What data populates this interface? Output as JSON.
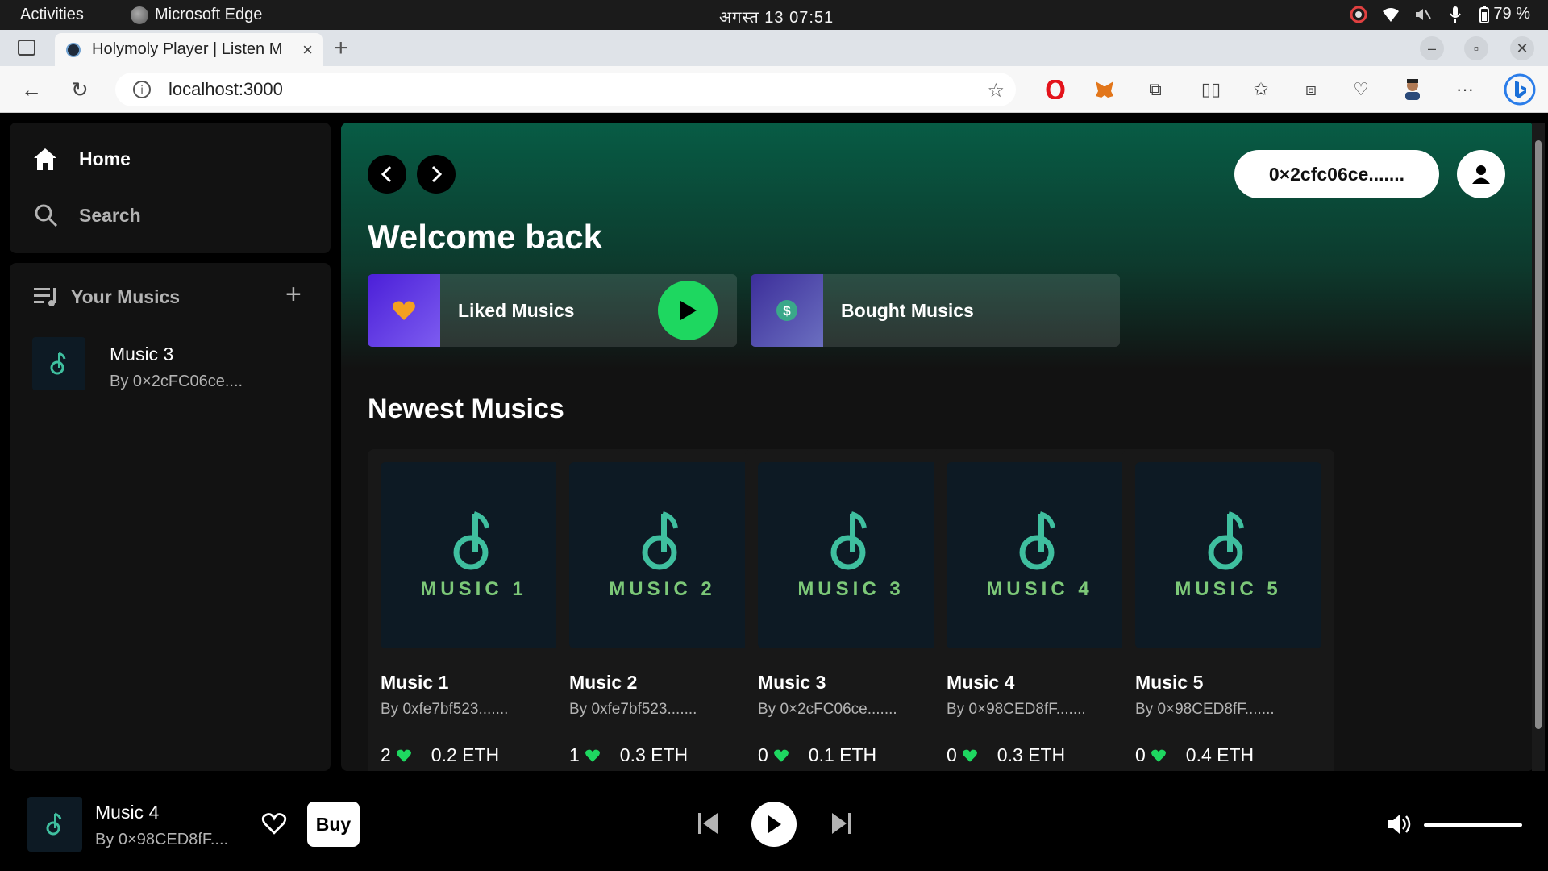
{
  "os": {
    "activities": "Activities",
    "app_name": "Microsoft Edge",
    "clock": "अगस्त 13  07:51",
    "battery": "79 %"
  },
  "browser": {
    "tab_title": "Holymoly Player | Listen M",
    "url": "localhost:3000"
  },
  "sidebar": {
    "home_label": "Home",
    "search_label": "Search",
    "library_label": "Your Musics",
    "library_items": [
      {
        "title": "Music 3",
        "by": "By 0×2cFC06ce...."
      }
    ]
  },
  "main": {
    "wallet_address": "0×2cfc06ce.......",
    "welcome": "Welcome back",
    "quick_links": [
      {
        "label": "Liked Musics"
      },
      {
        "label": "Bought Musics"
      }
    ],
    "section_title": "Newest Musics",
    "cards": [
      {
        "cover_text": "MUSIC 1",
        "title": "Music 1",
        "by": "By 0xfe7bf523.......",
        "likes": "2",
        "price": "0.2 ETH"
      },
      {
        "cover_text": "MUSIC 2",
        "title": "Music 2",
        "by": "By 0xfe7bf523.......",
        "likes": "1",
        "price": "0.3 ETH"
      },
      {
        "cover_text": "MUSIC 3",
        "title": "Music 3",
        "by": "By 0×2cFC06ce.......",
        "likes": "0",
        "price": "0.1 ETH"
      },
      {
        "cover_text": "MUSIC 4",
        "title": "Music 4",
        "by": "By 0×98CED8fF.......",
        "likes": "0",
        "price": "0.3 ETH"
      },
      {
        "cover_text": "MUSIC 5",
        "title": "Music 5",
        "by": "By 0×98CED8fF.......",
        "likes": "0",
        "price": "0.4 ETH"
      }
    ]
  },
  "player": {
    "title": "Music 4",
    "by": "By 0×98CED8fF....",
    "buy_label": "Buy",
    "volume_level": 1.0
  },
  "colors": {
    "accent_green": "#1ed760",
    "header_gradient_top": "#075c45",
    "panel": "#121212",
    "card": "#181818"
  }
}
